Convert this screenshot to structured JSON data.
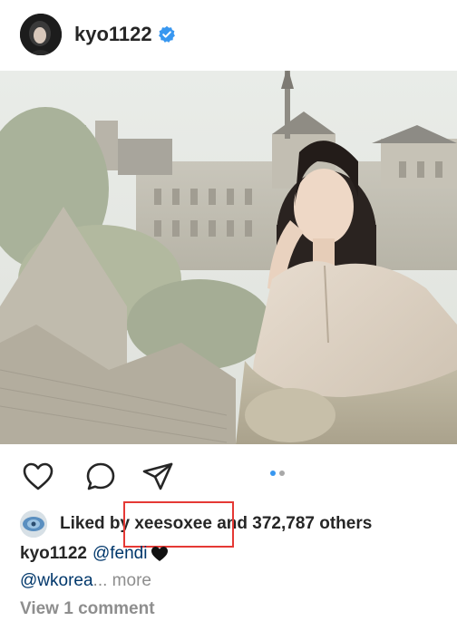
{
  "post": {
    "username": "kyo1122",
    "verified": true
  },
  "actions": {
    "like_icon": "heart-outline-icon",
    "comment_icon": "comment-bubble-icon",
    "share_icon": "paper-plane-icon"
  },
  "carousel": {
    "total": 2,
    "active_index": 0,
    "active_color": "#3897f0",
    "inactive_color": "#a8a8a8"
  },
  "likes": {
    "prefix": "Liked by ",
    "liker": "xeesoxee",
    "middle": " and ",
    "count": "372,787",
    "suffix": " others"
  },
  "caption": {
    "username": "kyo1122",
    "mention1": "@fendi",
    "mention2": "@wkorea",
    "ellipsis": "...",
    "more": " more"
  },
  "comments": {
    "view_label": "View 1 comment"
  },
  "colors": {
    "verified_blue": "#3897f0",
    "highlight_red": "#e53935",
    "link_blue": "#00376b"
  }
}
